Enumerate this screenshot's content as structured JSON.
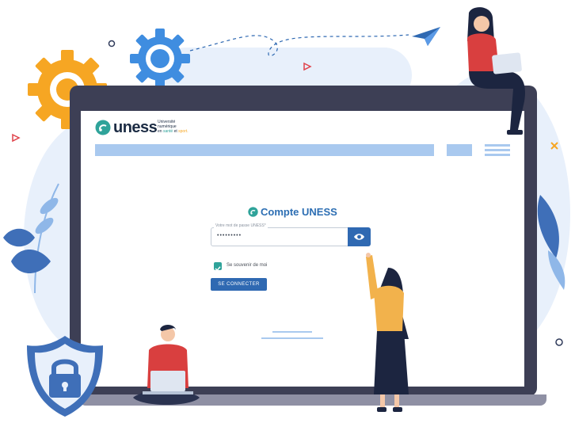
{
  "brand": {
    "name": "uness",
    "tagline_line1": "Université",
    "tagline_line2": "numérique",
    "tagline_line3_a": "en ",
    "tagline_line3_b": "santé",
    "tagline_line3_c": " et ",
    "tagline_line3_d": "sport."
  },
  "login": {
    "title": "Compte UNESS",
    "password_label": "Votre mot de passe UNESS*",
    "password_value": "•••••••••",
    "remember_label": "Se souvenir de moi",
    "remember_checked": true,
    "submit_label": "SE CONNECTER"
  },
  "colors": {
    "accent": "#2f69b2",
    "teal": "#2fa39a",
    "light_blue": "#a9c9ef",
    "frame": "#3d3f55",
    "gear_orange": "#f6a623",
    "gear_blue": "#3f8de0"
  },
  "icons": [
    "eye-icon",
    "uness-logo-icon",
    "gear-icon",
    "paper-plane-icon",
    "padlock-icon",
    "hamburger-icon"
  ]
}
